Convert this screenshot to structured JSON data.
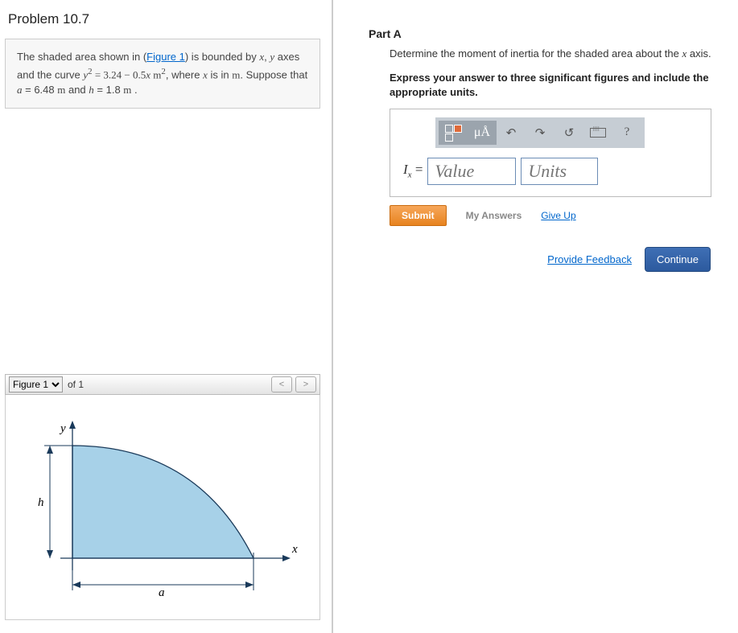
{
  "title": "Problem 10.7",
  "problem": {
    "preText": "The shaded area shown in (",
    "figureLink": "Figure 1",
    "postLink": ") is bounded by ",
    "var_x": "x",
    "sep1": ", ",
    "var_y": "y",
    "line2a": " axes and the curve ",
    "eq_lhs_y": "y",
    "eq_sup": "2",
    "eq_eq": " = 3.24 − 0.5",
    "eq_x": "x",
    "eq_unit": " m",
    "eq_unit_sup": "2",
    "line2b": ", where ",
    "var_x2": "x",
    "line2c": " is in ",
    "unit_m": "m",
    "line3a": ". Suppose that ",
    "var_a": "a",
    "val_a": " = 6.48 ",
    "unit_m2": " m",
    "and": " and ",
    "var_h": "h",
    "val_h": " = 1.8 ",
    "unit_m3": " m",
    "dot": " ."
  },
  "figureNav": {
    "select": "Figure 1",
    "ofLabel": "of 1",
    "prev": "<",
    "next": ">"
  },
  "figureLabels": {
    "y": "y",
    "x": "x",
    "h": "h",
    "a": "a"
  },
  "partA": {
    "title": "Part A",
    "desc1": "Determine the moment of inertia for the shaded area about the ",
    "desc_x": "x",
    "desc2": " axis.",
    "instruction": "Express your answer to three significant figures and include the appropriate units.",
    "muA": "μÅ",
    "ix_I": "I",
    "ix_sub": "x",
    "ix_eq": " =",
    "valuePlaceholder": "Value",
    "unitsPlaceholder": "Units",
    "submit": "Submit",
    "myAnswers": "My Answers",
    "giveUp": "Give Up",
    "help": "?"
  },
  "footer": {
    "feedback": "Provide Feedback",
    "continue": "Continue"
  }
}
